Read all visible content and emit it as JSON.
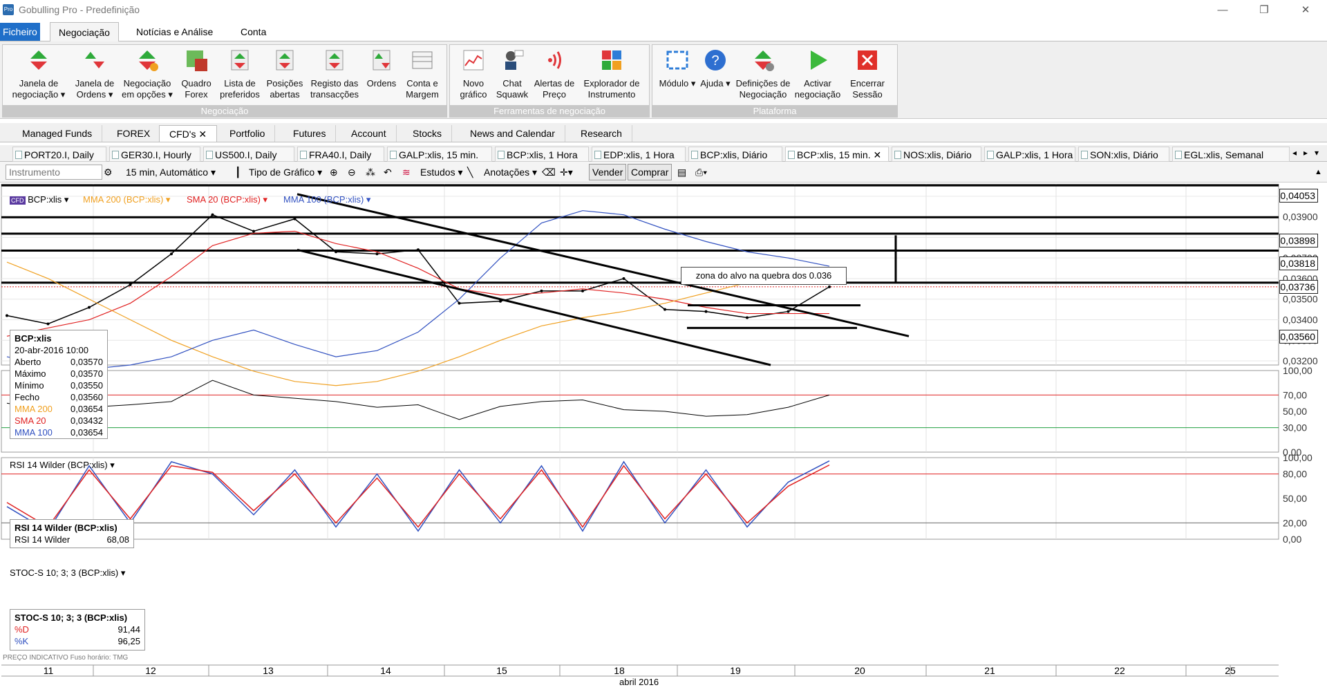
{
  "window": {
    "title": "Gobulling Pro - Predefinição",
    "minimize": "—",
    "restore": "❐",
    "close": "✕"
  },
  "menu": {
    "file": "Ficheiro",
    "tabs": [
      "Negociação",
      "Notícias e Análise",
      "Conta"
    ]
  },
  "ribbon": {
    "groups": [
      {
        "label": "Negociação",
        "buttons": [
          {
            "label": "Janela de negociação ▾",
            "icon": "triangle-updown-icon"
          },
          {
            "label": "Janela de Ordens ▾",
            "icon": "order-window-icon"
          },
          {
            "label": "Negociação em opções ▾",
            "icon": "options-trading-icon"
          },
          {
            "label": "Quadro Forex",
            "icon": "forex-board-icon"
          },
          {
            "label": "Lista de preferidos",
            "icon": "favorites-list-icon"
          },
          {
            "label": "Posições abertas",
            "icon": "open-positions-icon"
          },
          {
            "label": "Registo das transacções",
            "icon": "transactions-log-icon"
          },
          {
            "label": "Ordens",
            "icon": "orders-icon"
          },
          {
            "label": "Conta e Margem",
            "icon": "account-margin-icon"
          }
        ]
      },
      {
        "label": "Ferramentas de negociação",
        "buttons": [
          {
            "label": "Novo gráfico",
            "icon": "new-chart-icon"
          },
          {
            "label": "Chat Squawk",
            "icon": "chat-squawk-icon"
          },
          {
            "label": "Alertas de Preço",
            "icon": "price-alerts-icon"
          },
          {
            "label": "Explorador de Instrumento",
            "icon": "instrument-explorer-icon"
          }
        ]
      },
      {
        "label": "Plataforma",
        "buttons": [
          {
            "label": "Módulo ▾",
            "icon": "module-icon"
          },
          {
            "label": "Ajuda ▾",
            "icon": "help-icon"
          },
          {
            "label": "Definições de Negociação",
            "icon": "trading-settings-icon"
          },
          {
            "label": "Activar negociação",
            "icon": "play-icon"
          },
          {
            "label": "Encerrar Sessão",
            "icon": "close-session-icon"
          }
        ]
      }
    ]
  },
  "workspace_tabs": [
    "Managed Funds",
    "FOREX",
    "CFD's ✕",
    "Portfolio",
    "Futures",
    "Account",
    "Stocks",
    "News and Calendar",
    "Research"
  ],
  "chart_tabs": [
    "PORT20.I, Daily",
    "GER30.I, Hourly",
    "US500.I, Daily",
    "FRA40.I, Daily",
    "GALP:xlis, 15 min.",
    "BCP:xlis, 1 Hora",
    "EDP:xlis, 1 Hora",
    "BCP:xlis, Diário",
    "BCP:xlis, 15 min. ✕",
    "NOS:xlis, Diário",
    "GALP:xlis, 1 Hora",
    "SON:xlis, Diário",
    "EGL:xlis, Semanal"
  ],
  "toolbar": {
    "instrument_placeholder": "Instrumento",
    "interval": "15 min, Automático ▾",
    "chart_type": "Tipo de Gráfico ▾",
    "studies": "Estudos ▾",
    "annotations": "Anotações ▾",
    "sell": "Vender",
    "buy": "Comprar"
  },
  "main_header": {
    "symbol": "BCP:xlis ▾",
    "mma200": "MMA 200 (BCP:xlis) ▾",
    "sma20": "SMA 20 (BCP:xlis) ▾",
    "mma100": "MMA 100 (BCP:xlis) ▾"
  },
  "legend": {
    "title": "BCP:xlis",
    "date": "20-abr-2016 10:00",
    "rows": [
      {
        "k": "Aberto",
        "v": "0,03570"
      },
      {
        "k": "Máximo",
        "v": "0,03570"
      },
      {
        "k": "Mínimo",
        "v": "0,03550"
      },
      {
        "k": "Fecho",
        "v": "0,03560"
      },
      {
        "k": "MMA 200",
        "v": "0,03654"
      },
      {
        "k": "SMA 20",
        "v": "0,03432"
      },
      {
        "k": "MMA 100",
        "v": "0,03654"
      }
    ]
  },
  "annotation": "zona do alvo na quebra dos 0.036",
  "price_boxes": [
    "0,04053",
    "0,03898",
    "0,03818",
    "0,03736",
    "0,03560"
  ],
  "rsi_panel": {
    "header": "RSI 14 Wilder (BCP:xlis) ▾",
    "box_title": "RSI 14 Wilder (BCP:xlis)",
    "box_label": "RSI 14 Wilder",
    "box_value": "68,08",
    "axis": [
      "100,00",
      "70,00",
      "50,00",
      "30,00",
      "0,00"
    ]
  },
  "stoc_panel": {
    "header": "STOC-S 10; 3; 3 (BCP:xlis) ▾",
    "box_title": "STOC-S 10; 3; 3 (BCP:xlis)",
    "d_label": "%D",
    "d_value": "91,44",
    "k_label": "%K",
    "k_value": "96,25",
    "axis": [
      "100,00",
      "80,00",
      "50,00",
      "20,00",
      "0,00"
    ]
  },
  "footer_note": "PREÇO INDICATIVO   Fuso horário: TMG",
  "month_label": "abril 2016",
  "colors": {
    "mma200": "#f0a020",
    "sma20": "#e02020",
    "mma100": "#3050c0",
    "price": "#000000",
    "rsi_top": "#e02020",
    "rsi_bottom": "#20a040",
    "stoc_k": "#3050c0",
    "stoc_d": "#e02020"
  },
  "chart_data": {
    "type": "line",
    "title": "BCP:xlis",
    "x": [
      "11",
      "12",
      "13",
      "14",
      "15",
      "18",
      "19",
      "20",
      "21",
      "22",
      "25"
    ],
    "ylim": [
      0.0318,
      0.0406
    ],
    "y_ticks": [
      "0,04000",
      "0,03900",
      "0,03800",
      "0,03700",
      "0,03600",
      "0,03500",
      "0,03400",
      "0,03300",
      "0,03200"
    ],
    "series": [
      {
        "name": "BCP:xlis",
        "values": [
          0.0342,
          0.0338,
          0.0346,
          0.0357,
          0.0372,
          0.0391,
          0.0383,
          0.0389,
          0.0373,
          0.0372,
          0.0374,
          0.0348,
          0.0349,
          0.0354,
          0.0354,
          0.036,
          0.0345,
          0.0344,
          0.0341,
          0.0344,
          0.0356
        ]
      },
      {
        "name": "SMA 20",
        "values": [
          0.0332,
          0.0336,
          0.034,
          0.0348,
          0.0361,
          0.0376,
          0.0382,
          0.0383,
          0.0377,
          0.0373,
          0.0365,
          0.0355,
          0.0352,
          0.0353,
          0.0355,
          0.0353,
          0.035,
          0.0346,
          0.0343,
          0.0343,
          0.0343
        ]
      },
      {
        "name": "MMA 200",
        "values": [
          0.0368,
          0.036,
          0.035,
          0.034,
          0.033,
          0.0322,
          0.0315,
          0.031,
          0.0308,
          0.031,
          0.0315,
          0.0322,
          0.033,
          0.0337,
          0.0341,
          0.0344,
          0.0348,
          0.0353,
          0.0358,
          0.0363,
          0.0365
        ]
      },
      {
        "name": "MMA 100",
        "values": [
          0.0322,
          0.0318,
          0.0316,
          0.0318,
          0.0322,
          0.033,
          0.0335,
          0.0328,
          0.0322,
          0.0325,
          0.0334,
          0.035,
          0.037,
          0.0387,
          0.0393,
          0.0391,
          0.0384,
          0.0378,
          0.0373,
          0.037,
          0.0366
        ]
      }
    ],
    "horizontal_levels": [
      0.04053,
      0.03898,
      0.03818,
      0.03736,
      0.0358,
      0.0356
    ],
    "rsi": [
      60,
      52,
      55,
      58,
      62,
      88,
      70,
      66,
      62,
      55,
      58,
      40,
      56,
      62,
      64,
      52,
      50,
      44,
      46,
      55,
      70
    ],
    "stoc_k": [
      40,
      10,
      90,
      20,
      95,
      80,
      30,
      85,
      15,
      80,
      10,
      85,
      20,
      90,
      10,
      95,
      20,
      85,
      15,
      70,
      96
    ],
    "stoc_d": [
      45,
      15,
      85,
      25,
      90,
      82,
      35,
      80,
      20,
      75,
      15,
      80,
      25,
      85,
      15,
      90,
      25,
      80,
      20,
      65,
      91
    ]
  }
}
